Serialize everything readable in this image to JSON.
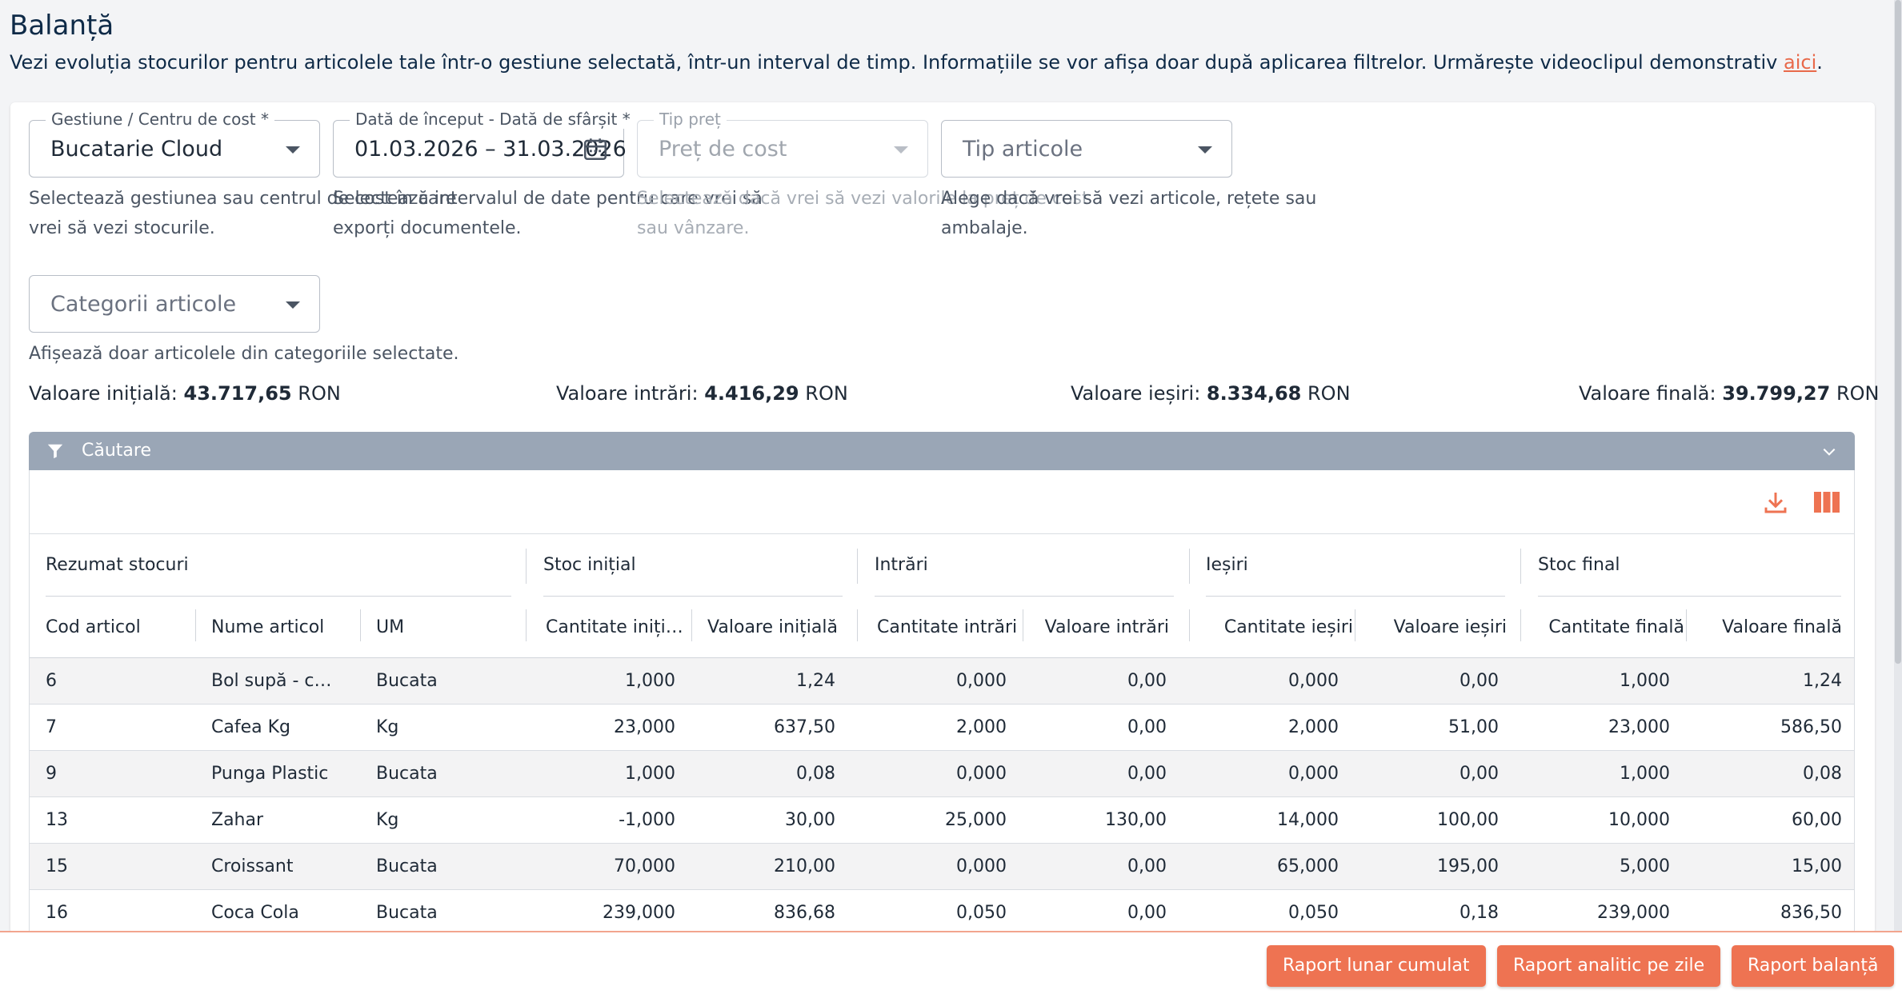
{
  "page": {
    "title": "Balanță",
    "description": "Vezi evoluția stocurilor pentru articolele tale într-o gestiune selectată, într-un interval de timp. Informațiile se vor afișa doar după aplicarea filtrelor. Urmărește videoclipul demonstrativ ",
    "link_text": "aici",
    "description_end": "."
  },
  "filters": {
    "gestiune": {
      "label": "Gestiune / Centru de cost *",
      "value": "Bucatarie Cloud",
      "help": [
        "Selectează gestiunea sau centrul de cost în care",
        "vrei să vezi stocurile."
      ]
    },
    "date": {
      "label": "Dată de început - Dată de sfârșit *",
      "value": "01.03.2026 – 31.03.2026",
      "help": [
        "Selectează intervalul de date pentru care vrei să",
        "exporți documentele."
      ]
    },
    "tip_pret": {
      "label": "Tip preț",
      "placeholder": "Preț de cost",
      "help": [
        "Selectează dacă vrei să vezi valorile la preț de cost",
        "sau vânzare."
      ]
    },
    "tip_articole": {
      "placeholder": "Tip articole",
      "help": [
        "Alege dacă vrei să vezi articole, rețete sau",
        "ambalaje."
      ]
    },
    "categorii": {
      "placeholder": "Categorii articole",
      "help": [
        "Afișează doar articolele din categoriile selectate."
      ]
    }
  },
  "totals": {
    "initiala_label": "Valoare inițială:",
    "initiala_value": "43.717,65",
    "intrari_label": "Valoare intrări:",
    "intrari_value": "4.416,29",
    "iesiri_label": "Valoare ieșiri:",
    "iesiri_value": "8.334,68",
    "finala_label": "Valoare finală:",
    "finala_value": "39.799,27",
    "currency": "RON"
  },
  "search": {
    "label": "Căutare"
  },
  "table": {
    "groups": [
      "Rezumat stocuri",
      "Stoc inițial",
      "Intrări",
      "Ieșiri",
      "Stoc final"
    ],
    "columns": [
      "Cod articol",
      "Nume articol",
      "UM",
      "Cantitate inițială",
      "Valoare inițială",
      "Cantitate intrări",
      "Valoare intrări",
      "Cantitate ieșiri",
      "Valoare ieșiri",
      "Cantitate finală",
      "Valoare finală"
    ],
    "rows": [
      [
        "6",
        "Bol supă - carton",
        "Bucata",
        "1,000",
        "1,24",
        "0,000",
        "0,00",
        "0,000",
        "0,00",
        "1,000",
        "1,24"
      ],
      [
        "7",
        "Cafea Kg",
        "Kg",
        "23,000",
        "637,50",
        "2,000",
        "0,00",
        "2,000",
        "51,00",
        "23,000",
        "586,50"
      ],
      [
        "9",
        "Punga Plastic",
        "Bucata",
        "1,000",
        "0,08",
        "0,000",
        "0,00",
        "0,000",
        "0,00",
        "1,000",
        "0,08"
      ],
      [
        "13",
        "Zahar",
        "Kg",
        "-1,000",
        "30,00",
        "25,000",
        "130,00",
        "14,000",
        "100,00",
        "10,000",
        "60,00"
      ],
      [
        "15",
        "Croissant",
        "Bucata",
        "70,000",
        "210,00",
        "0,000",
        "0,00",
        "65,000",
        "195,00",
        "5,000",
        "15,00"
      ],
      [
        "16",
        "Coca Cola",
        "Bucata",
        "239,000",
        "836,68",
        "0,050",
        "0,00",
        "0,050",
        "0,18",
        "239,000",
        "836,50"
      ]
    ]
  },
  "buttons": {
    "lunar": "Raport lunar cumulat",
    "analitic": "Raport analitic pe zile",
    "balanta": "Raport balanță"
  },
  "colors": {
    "accent": "#ee7352",
    "search_bar": "#9aa6b6",
    "title": "#0e2a47"
  }
}
